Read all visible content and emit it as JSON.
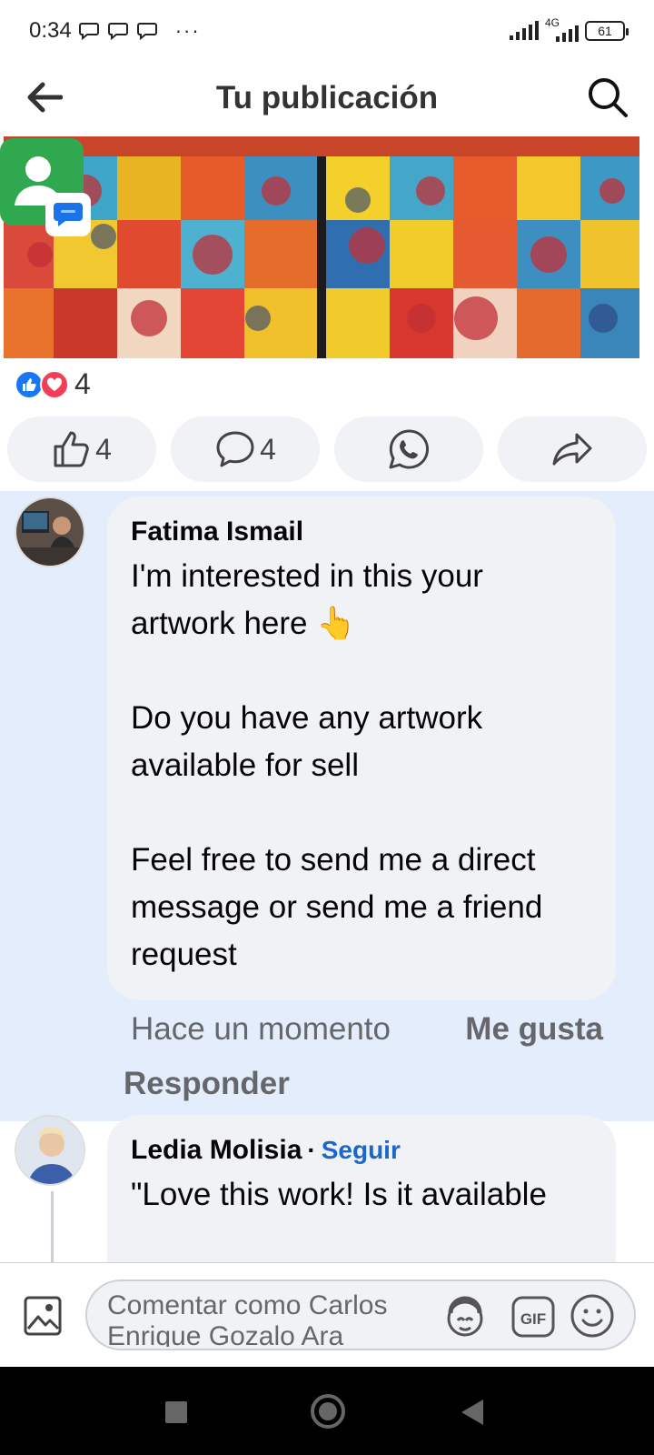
{
  "status_bar": {
    "time": "0:34",
    "dots": "···",
    "network": "4G",
    "battery": "61"
  },
  "header": {
    "title": "Tu publicación"
  },
  "post": {
    "reaction_count": "4",
    "actions": {
      "like_count": "4",
      "comment_count": "4"
    }
  },
  "comments": [
    {
      "author": "Fatima Ismail",
      "text": "I'm interested in this your\nartwork here 👆\n\nDo you have any artwork\navailable for sell\n\nFeel free to send me a direct\nmessage or send me a friend\nrequest",
      "time": "Hace un momento",
      "like_label": "Me gusta",
      "reply_label": "Responder"
    },
    {
      "author": "Ledia Molisia",
      "follow_label": "Seguir",
      "text": "\"Love this work! Is it available"
    }
  ],
  "composer": {
    "placeholder": "Comentar como Carlos Enrique Gozalo Ara"
  },
  "colors": {
    "accent": "#1877f2",
    "love": "#f33e58",
    "highlight_bg": "#e3edfc",
    "bubble_bg": "#f0f2f5",
    "follow_link": "#1b66c9"
  }
}
